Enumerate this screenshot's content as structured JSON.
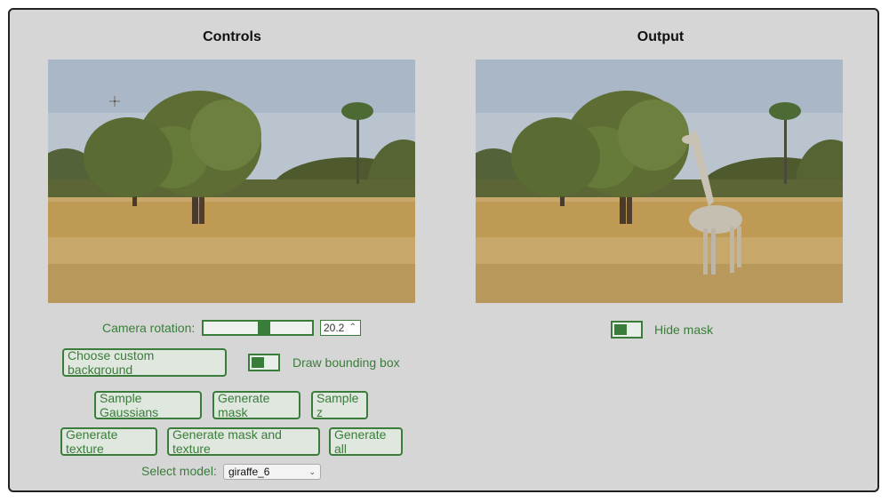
{
  "controls": {
    "heading": "Controls",
    "camera_rotation_label": "Camera rotation:",
    "camera_rotation_value": "20.2",
    "camera_rotation_slider_fraction": 0.5,
    "choose_background_label": "Choose custom background",
    "draw_bounding_box_label": "Draw bounding box",
    "sample_gaussians_label": "Sample Gaussians",
    "generate_mask_label": "Generate mask",
    "sample_z_label": "Sample z",
    "generate_texture_label": "Generate texture",
    "generate_mask_and_texture_label": "Generate mask and texture",
    "generate_all_label": "Generate all",
    "select_model_label": "Select model:",
    "select_model_value": "giraffe_6"
  },
  "output": {
    "heading": "Output",
    "hide_mask_label": "Hide mask"
  },
  "icons": {
    "cursor": "crosshair-cursor-icon",
    "spinner": "spinner-arrows-icon",
    "select_caret": "chevron-down-icon"
  },
  "colors": {
    "accent": "#3a7d3a",
    "panel_bg": "#d6d6d6"
  }
}
